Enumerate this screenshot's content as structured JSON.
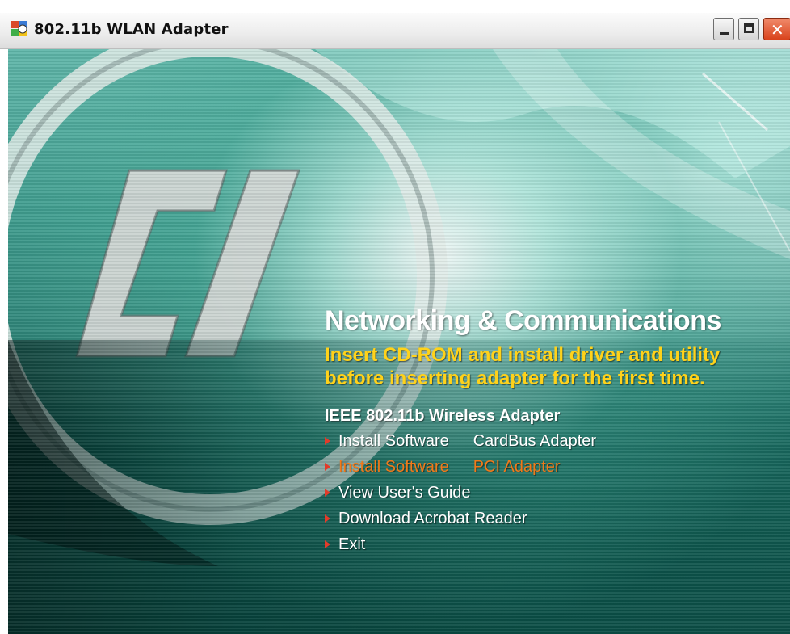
{
  "window": {
    "title": "802.11b WLAN Adapter",
    "app_icon": "setup-app-icon",
    "controls": [
      "minimize-icon",
      "maximize-icon",
      "close-icon"
    ]
  },
  "main": {
    "heading": "Networking & Communications",
    "notice_line1": "Insert CD-ROM and install driver and utility",
    "notice_line2": "before inserting adapter for the first time.",
    "product": "IEEE 802.11b Wireless Adapter",
    "menu": [
      {
        "label": "Install Software",
        "sub": "CardBus Adapter"
      },
      {
        "label": "Install Software",
        "sub": "PCI Adapter"
      },
      {
        "label": "View User's Guide",
        "sub": ""
      },
      {
        "label": "Download Acrobat Reader",
        "sub": ""
      },
      {
        "label": "Exit",
        "sub": ""
      }
    ]
  },
  "colors": {
    "notice": "#ffd21a",
    "menu_active": "#f07a1a",
    "bullet": "#e23b2a",
    "background_teal": "#2b7f73"
  }
}
